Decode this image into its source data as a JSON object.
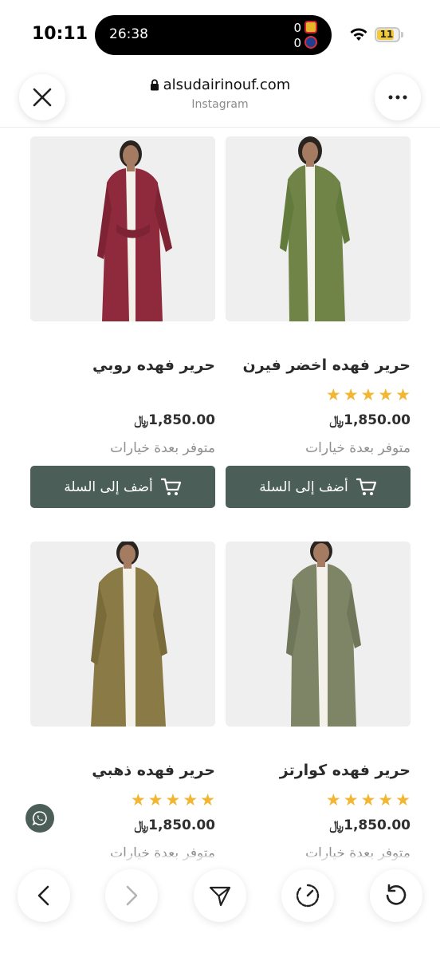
{
  "status_bar": {
    "time": "10:11",
    "live_activity": {
      "timer": "26:38",
      "score_home": "0",
      "score_away": "0"
    },
    "battery": "11"
  },
  "browser": {
    "url": "alsudairinouf.com",
    "source": "Instagram"
  },
  "products": [
    {
      "title": "حرير فهده روبي",
      "price": "1,850.00",
      "availability": "متوفر بعدة خيارات",
      "button": "أضف إلى السلة",
      "stars": 0,
      "color": "#8e2a3c"
    },
    {
      "title": "حرير فهده اخضر فيرن",
      "price": "1,850.00",
      "availability": "متوفر بعدة خيارات",
      "button": "أضف إلى السلة",
      "stars": 5,
      "color": "#6f8446"
    },
    {
      "title": "حرير فهده ذهبي",
      "price": "1,850.00",
      "availability": "متوفر بعدة خيارات",
      "stars": 5,
      "color": "#8a7a45"
    },
    {
      "title": "حرير فهده كوارتز",
      "price": "1,850.00",
      "availability": "متوفر بعدة خيارات",
      "stars": 5,
      "color": "#7e8566"
    }
  ],
  "colors": {
    "accent": "#4b5f58",
    "star": "#f2b632"
  },
  "icons": [
    "close-icon",
    "more-icon",
    "lock-icon",
    "cart-icon",
    "whatsapp-icon",
    "back-icon",
    "forward-icon",
    "share-icon",
    "timer-icon",
    "reload-icon"
  ]
}
